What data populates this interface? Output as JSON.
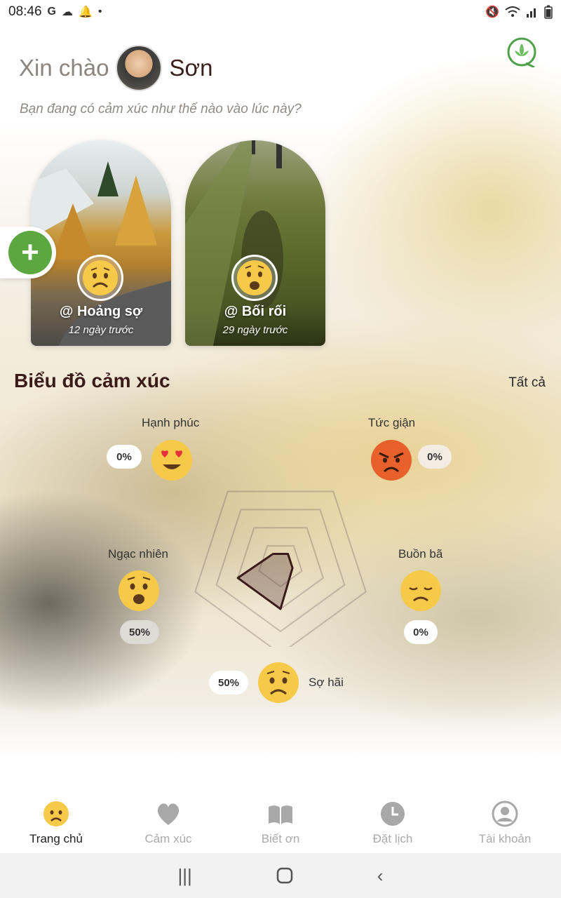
{
  "status_bar": {
    "time": "08:46",
    "left_icons": [
      "google-icon",
      "cloud-icon",
      "bell-icon",
      "dot-icon"
    ],
    "right_icons": [
      "mute-icon",
      "wifi-icon",
      "signal-icon",
      "battery-icon"
    ]
  },
  "header": {
    "greeting": "Xin chào",
    "user_name": "Sơn",
    "prompt": "Bạn đang có cảm xúc như thế nào vào lúc này?"
  },
  "mood_cards": [
    {
      "tag": "@ Hoảng sợ",
      "time": "12 ngày trước",
      "emoji": "worried-face"
    },
    {
      "tag": "@ Bối rối",
      "time": "29 ngày trước",
      "emoji": "astonished-face"
    }
  ],
  "chart_section": {
    "title": "Biểu đồ cảm xúc",
    "see_all": "Tất cả"
  },
  "chart_data": {
    "type": "radar",
    "axes": [
      "Hạnh phúc",
      "Tức giận",
      "Buồn bã",
      "Sợ hãi",
      "Ngạc nhiên"
    ],
    "values": [
      0,
      0,
      0,
      50,
      50
    ],
    "value_labels": [
      "0%",
      "0%",
      "0%",
      "50%",
      "50%"
    ],
    "ylim": [
      0,
      100
    ]
  },
  "colors": {
    "accent_green": "#5aa83f",
    "title_brown": "#3b1a1a",
    "radar_fill": "#5c3a3a"
  },
  "bottom_nav": [
    {
      "label": "Trang chủ",
      "icon": "worried-face-icon",
      "active": true
    },
    {
      "label": "Cảm xúc",
      "icon": "heart-icon",
      "active": false
    },
    {
      "label": "Biết ơn",
      "icon": "book-icon",
      "active": false
    },
    {
      "label": "Đặt lịch",
      "icon": "clock-icon",
      "active": false
    },
    {
      "label": "Tài khoản",
      "icon": "user-icon",
      "active": false
    }
  ],
  "system_nav": [
    "recent-apps-icon",
    "home-icon",
    "back-icon"
  ]
}
